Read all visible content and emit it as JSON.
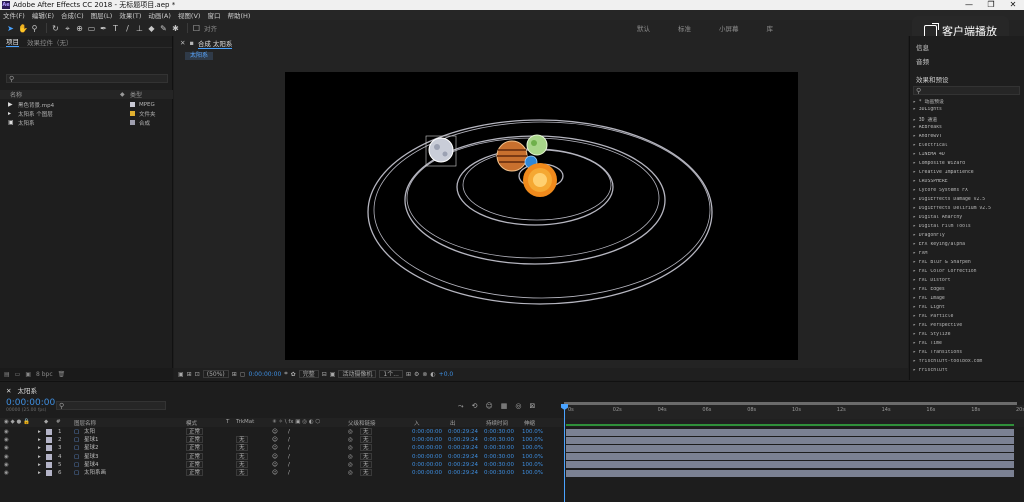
{
  "titlebar": {
    "title": "Adobe After Effects CC 2018 - 无标题项目.aep *",
    "min": "—",
    "max": "❐",
    "close": "✕"
  },
  "menu": [
    "文件(F)",
    "编辑(E)",
    "合成(C)",
    "图层(L)",
    "效果(T)",
    "动画(A)",
    "视图(V)",
    "窗口",
    "帮助(H)"
  ],
  "toolbar": {
    "align_label": "对齐",
    "workspaces": [
      "默认",
      "标准",
      "小屏幕",
      "库"
    ]
  },
  "client_button": {
    "label": "客户端播放"
  },
  "project": {
    "tab_project": "项目",
    "tab_effects": "效果控件（无）",
    "columns": {
      "name": "名称",
      "type": "类型"
    },
    "items": [
      {
        "name": "黑色背景.mp4",
        "type": "MPEG",
        "color": "#c9c9d4",
        "icon": "▶"
      },
      {
        "name": "太阳系 个图层",
        "type": "文件夹",
        "color": "#e0b030",
        "icon": "▸"
      },
      {
        "name": "太阳系",
        "type": "合成",
        "color": "#a0a0b0",
        "icon": "▣"
      }
    ],
    "footer_bpc": "8 bpc"
  },
  "comp": {
    "tab_label": "合成 太阳系",
    "sub_tab": "太阳系",
    "zoom": "(50%)",
    "timecode": "0:00:00:00",
    "resolution": "完整",
    "camera": "活动摄像机",
    "views": "1个...",
    "exposure": "+0.0"
  },
  "effects": {
    "sec_info": "信息",
    "sec_audio": "音频",
    "sec_fx": "效果和预设",
    "items": [
      "▸ * 动画预设",
      "▸ 3DLights",
      "▸ 3D 通道",
      "▸ AEBreaks",
      "▸ AndrewVT",
      "▸ Electrical",
      "▸ CINEMA 4D",
      "▸ Composite Wizard",
      "▸ Creative Impatience",
      "▸ CROSSPHERE",
      "▸ Cycore Systems FX",
      "▸ DigiEffects Damage v2.5",
      "▸ DigiEffects Delirium v2.5",
      "▸ Digital Anarchy",
      "▸ Digital Film Tools",
      "▸ DragonFly",
      "▸ EFX keying/alpha",
      "▸ FXM",
      "▸ FXC Blur & Sharpen",
      "▸ FXC Color Correction",
      "▸ FXC Distort",
      "▸ FXC Edges",
      "▸ FXC Image",
      "▸ FXC Light",
      "▸ FXC Particle",
      "▸ FXC Perspective",
      "▸ FXC Stylize",
      "▸ FXC Time",
      "▸ FXC Transitions",
      "▸ frischluft-toolbox.com",
      "▸ Frischluft"
    ]
  },
  "timeline": {
    "tab": "太阳系",
    "timecode": "0:00:00:00",
    "timecode_sub": "00000 (25.00 fps)",
    "columns": {
      "layer_name": "图层名称",
      "mode": "模式",
      "t": "T",
      "trkmat": "TrkMat",
      "parent": "父级和链接",
      "in": "入",
      "out": "出",
      "duration": "持续时间",
      "stretch": "伸缩"
    },
    "rows": [
      {
        "num": "1",
        "name": "太阳",
        "mode": "正常",
        "trk": "",
        "parent": "无",
        "in": "0:00:00:00",
        "out": "0:00:29:24",
        "dur": "0:00:30:00",
        "stretch": "100.0%"
      },
      {
        "num": "2",
        "name": "星球1",
        "mode": "正常",
        "trk": "无",
        "parent": "无",
        "in": "0:00:00:00",
        "out": "0:00:29:24",
        "dur": "0:00:30:00",
        "stretch": "100.0%"
      },
      {
        "num": "3",
        "name": "星球2",
        "mode": "正常",
        "trk": "无",
        "parent": "无",
        "in": "0:00:00:00",
        "out": "0:00:29:24",
        "dur": "0:00:30:00",
        "stretch": "100.0%"
      },
      {
        "num": "4",
        "name": "星球3",
        "mode": "正常",
        "trk": "无",
        "parent": "无",
        "in": "0:00:00:00",
        "out": "0:00:29:24",
        "dur": "0:00:30:00",
        "stretch": "100.0%"
      },
      {
        "num": "5",
        "name": "星球4",
        "mode": "正常",
        "trk": "无",
        "parent": "无",
        "in": "0:00:00:00",
        "out": "0:00:29:24",
        "dur": "0:00:30:00",
        "stretch": "100.0%"
      },
      {
        "num": "6",
        "name": "太阳系画",
        "mode": "正常",
        "trk": "无",
        "parent": "无",
        "in": "0:00:00:00",
        "out": "0:00:29:24",
        "dur": "0:00:30:00",
        "stretch": "100.0%"
      }
    ],
    "ruler": [
      "0s",
      "02s",
      "04s",
      "06s",
      "08s",
      "10s",
      "12s",
      "14s",
      "16s",
      "18s",
      "20s"
    ]
  }
}
